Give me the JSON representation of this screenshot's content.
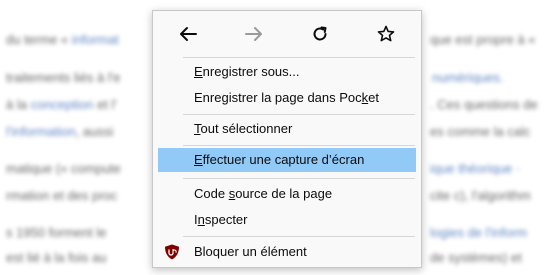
{
  "background": {
    "lines": [
      {
        "pre": "du terme « ",
        "link": "informat",
        "post": ""
      },
      {
        "pre": "traitements liés à l'e",
        "link": "",
        "post": ""
      },
      {
        "pre": "à la ",
        "link": "conception",
        "post": " et l'"
      },
      {
        "pre": "",
        "link": "l'information",
        "post": ", aussi"
      },
      {
        "pre": "matique (« compute",
        "link": "",
        "post": ""
      },
      {
        "pre": "rmation et des proc",
        "link": "",
        "post": ""
      },
      {
        "pre": "s 1950 forment le",
        "link": "",
        "post": ""
      },
      {
        "pre": "est lié à la fois au",
        "link": "",
        "post": ""
      }
    ],
    "right_lines": [
      {
        "text": "que est propre à «"
      },
      {
        "text": "numériques."
      },
      {
        "text": ". Ces questions de"
      },
      {
        "text": "es comme la calc"
      },
      {
        "text": "ique théorique ·"
      },
      {
        "text": "cite c), l'algorithm"
      },
      {
        "text": "logies de l'inform"
      },
      {
        "text": "de systèmes) et"
      }
    ]
  },
  "menu": {
    "nav": {
      "back_icon": "arrow-left-icon",
      "forward_icon": "arrow-right-icon",
      "reload_icon": "reload-icon",
      "bookmark_icon": "star-icon"
    },
    "items": [
      {
        "before": "",
        "accel": "E",
        "after": "nregistrer sous..."
      },
      {
        "before": "Enregistrer la page dans Poc",
        "accel": "k",
        "after": "et"
      },
      {
        "before": "",
        "accel": "T",
        "after": "out sélectionner"
      },
      {
        "before": "",
        "accel": "E",
        "after": "ffectuer une capture d’écran"
      },
      {
        "before": "Code ",
        "accel": "s",
        "after": "ource de la page"
      },
      {
        "before": "I",
        "accel": "n",
        "after": "specter"
      },
      {
        "before": "",
        "accel": "",
        "after": "Bloquer un élément"
      }
    ],
    "hover_index": 3,
    "ublock_icon": "ublock-origin-icon",
    "colors": {
      "hover": "#91c9f7",
      "menu_bg": "#f9f9fa",
      "ublock_red": "#800000"
    }
  }
}
